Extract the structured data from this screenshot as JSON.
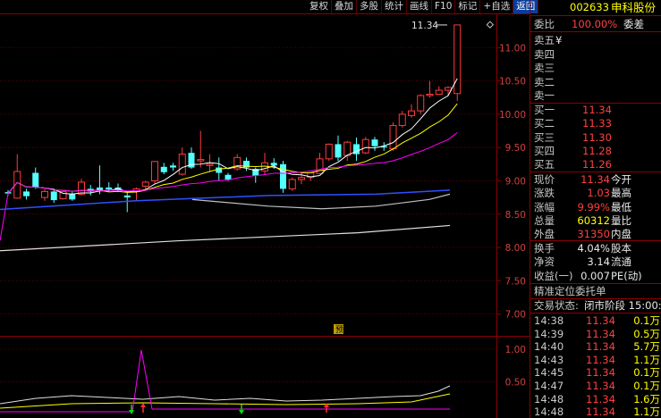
{
  "toolbar": [
    "复权",
    "叠加",
    "多股",
    "统计",
    "画线",
    "F10",
    "标记",
    "+自选",
    "返回"
  ],
  "stock": {
    "code": "002633",
    "name": "申科股份"
  },
  "ratio": {
    "label": "委比",
    "value": "100.00%",
    "label2": "委差"
  },
  "asks": [
    {
      "label": "卖五",
      "mark": "¥"
    },
    {
      "label": "卖四"
    },
    {
      "label": "卖三"
    },
    {
      "label": "卖二"
    },
    {
      "label": "卖一"
    }
  ],
  "bids": [
    {
      "label": "买一",
      "price": "11.34"
    },
    {
      "label": "买二",
      "price": "11.33"
    },
    {
      "label": "买三",
      "price": "11.30"
    },
    {
      "label": "买四",
      "price": "11.28"
    },
    {
      "label": "买五",
      "price": "11.26"
    }
  ],
  "quote": [
    {
      "l": "现价",
      "v": "11.34",
      "r": "今开"
    },
    {
      "l": "涨跌",
      "v": "1.03",
      "r": "最高"
    },
    {
      "l": "涨幅",
      "v": "9.99%",
      "r": "最低"
    },
    {
      "l": "总量",
      "v": "60312",
      "r": "量比"
    },
    {
      "l": "外盘",
      "v": "31350",
      "r": "内盘"
    }
  ],
  "fundamentals": [
    {
      "l": "换手",
      "v": "4.04%",
      "r": "股本"
    },
    {
      "l": "净资",
      "v": "3.14",
      "r": "流通"
    },
    {
      "l": "收益(一)",
      "v": "0.007",
      "r": "PE(动)"
    }
  ],
  "order_title": "精准定位委托单",
  "trade_status": {
    "label": "交易状态:",
    "value": "闭市阶段 15:00:"
  },
  "ticks": [
    {
      "t": "14:38",
      "p": "11.34",
      "v": "0.1万"
    },
    {
      "t": "14:39",
      "p": "11.34",
      "v": "0.5万"
    },
    {
      "t": "14:40",
      "p": "11.34",
      "v": "5.7万"
    },
    {
      "t": "14:43",
      "p": "11.34",
      "v": "1.1万"
    },
    {
      "t": "14:45",
      "p": "11.34",
      "v": "0.1万"
    },
    {
      "t": "14:47",
      "p": "11.34",
      "v": "0.1万"
    },
    {
      "t": "14:48",
      "p": "11.34",
      "v": "1.6万"
    },
    {
      "t": "14:48",
      "p": "11.34",
      "v": "1.1万"
    }
  ],
  "price_axis": [
    "11.00",
    "10.50",
    "10.00",
    "9.50",
    "9.00",
    "8.50",
    "8.00",
    "7.50",
    "7.00"
  ],
  "ind_axis": [
    "1.00",
    "0.50"
  ],
  "last_price_label": "11.34",
  "badge": "预",
  "chart_data": {
    "type": "candlestick",
    "ylim": [
      6.7,
      11.5
    ],
    "candles": [
      {
        "o": 8.83,
        "h": 8.86,
        "l": 8.78,
        "c": 8.81
      },
      {
        "o": 8.74,
        "h": 9.4,
        "l": 8.73,
        "c": 9.14
      },
      {
        "o": 8.84,
        "h": 8.88,
        "l": 8.72,
        "c": 8.77
      },
      {
        "o": 9.12,
        "h": 9.2,
        "l": 8.88,
        "c": 8.9
      },
      {
        "o": 8.75,
        "h": 8.88,
        "l": 8.7,
        "c": 8.84
      },
      {
        "o": 8.84,
        "h": 8.88,
        "l": 8.67,
        "c": 8.71
      },
      {
        "o": 8.73,
        "h": 8.86,
        "l": 8.72,
        "c": 8.84
      },
      {
        "o": 8.8,
        "h": 8.83,
        "l": 8.7,
        "c": 8.72
      },
      {
        "o": 8.8,
        "h": 9.03,
        "l": 8.78,
        "c": 8.98
      },
      {
        "o": 8.88,
        "h": 8.94,
        "l": 8.78,
        "c": 8.84
      },
      {
        "o": 8.9,
        "h": 9.23,
        "l": 8.8,
        "c": 8.86
      },
      {
        "o": 8.9,
        "h": 8.98,
        "l": 8.84,
        "c": 8.87
      },
      {
        "o": 8.9,
        "h": 8.96,
        "l": 8.83,
        "c": 8.86
      },
      {
        "o": 8.78,
        "h": 8.83,
        "l": 8.53,
        "c": 8.75
      },
      {
        "o": 8.85,
        "h": 8.9,
        "l": 8.7,
        "c": 8.88
      },
      {
        "o": 8.92,
        "h": 9.0,
        "l": 8.85,
        "c": 8.98
      },
      {
        "o": 9.0,
        "h": 9.3,
        "l": 8.96,
        "c": 9.29
      },
      {
        "o": 9.21,
        "h": 9.27,
        "l": 9.1,
        "c": 9.13
      },
      {
        "o": 9.23,
        "h": 9.27,
        "l": 9.15,
        "c": 9.2
      },
      {
        "o": 9.1,
        "h": 9.5,
        "l": 9.08,
        "c": 9.4
      },
      {
        "o": 9.42,
        "h": 9.5,
        "l": 9.18,
        "c": 9.2
      },
      {
        "o": 9.3,
        "h": 9.75,
        "l": 9.2,
        "c": 9.32
      },
      {
        "o": 9.23,
        "h": 9.4,
        "l": 9.13,
        "c": 9.25
      },
      {
        "o": 9.2,
        "h": 9.35,
        "l": 9.0,
        "c": 9.12
      },
      {
        "o": 9.09,
        "h": 9.12,
        "l": 9.0,
        "c": 9.02
      },
      {
        "o": 9.18,
        "h": 9.4,
        "l": 9.15,
        "c": 9.35
      },
      {
        "o": 9.3,
        "h": 9.35,
        "l": 9.15,
        "c": 9.2
      },
      {
        "o": 9.18,
        "h": 9.2,
        "l": 8.97,
        "c": 9.08
      },
      {
        "o": 9.15,
        "h": 9.42,
        "l": 9.1,
        "c": 9.27
      },
      {
        "o": 9.27,
        "h": 9.34,
        "l": 9.18,
        "c": 9.23
      },
      {
        "o": 9.25,
        "h": 9.3,
        "l": 8.82,
        "c": 8.88
      },
      {
        "o": 8.88,
        "h": 9.05,
        "l": 8.85,
        "c": 9.02
      },
      {
        "o": 9.02,
        "h": 9.12,
        "l": 8.95,
        "c": 9.05
      },
      {
        "o": 9.05,
        "h": 9.13,
        "l": 9.0,
        "c": 9.12
      },
      {
        "o": 9.11,
        "h": 9.42,
        "l": 9.1,
        "c": 9.33
      },
      {
        "o": 9.33,
        "h": 9.56,
        "l": 9.3,
        "c": 9.55
      },
      {
        "o": 9.55,
        "h": 9.68,
        "l": 9.3,
        "c": 9.35
      },
      {
        "o": 9.38,
        "h": 9.6,
        "l": 9.3,
        "c": 9.58
      },
      {
        "o": 9.55,
        "h": 9.65,
        "l": 9.3,
        "c": 9.4
      },
      {
        "o": 9.42,
        "h": 9.66,
        "l": 9.4,
        "c": 9.62
      },
      {
        "o": 9.62,
        "h": 9.66,
        "l": 9.45,
        "c": 9.52
      },
      {
        "o": 9.52,
        "h": 9.58,
        "l": 9.45,
        "c": 9.5
      },
      {
        "o": 9.48,
        "h": 9.88,
        "l": 9.45,
        "c": 9.83
      },
      {
        "o": 9.83,
        "h": 10.05,
        "l": 9.8,
        "c": 10.0
      },
      {
        "o": 9.98,
        "h": 10.15,
        "l": 9.95,
        "c": 10.05
      },
      {
        "o": 10.05,
        "h": 10.3,
        "l": 10.0,
        "c": 10.28
      },
      {
        "o": 10.28,
        "h": 10.5,
        "l": 10.25,
        "c": 10.3
      },
      {
        "o": 10.3,
        "h": 10.42,
        "l": 10.3,
        "c": 10.36
      },
      {
        "o": 10.36,
        "h": 10.42,
        "l": 10.28,
        "c": 10.4
      },
      {
        "o": 10.31,
        "h": 11.34,
        "l": 10.2,
        "c": 11.34
      }
    ]
  }
}
